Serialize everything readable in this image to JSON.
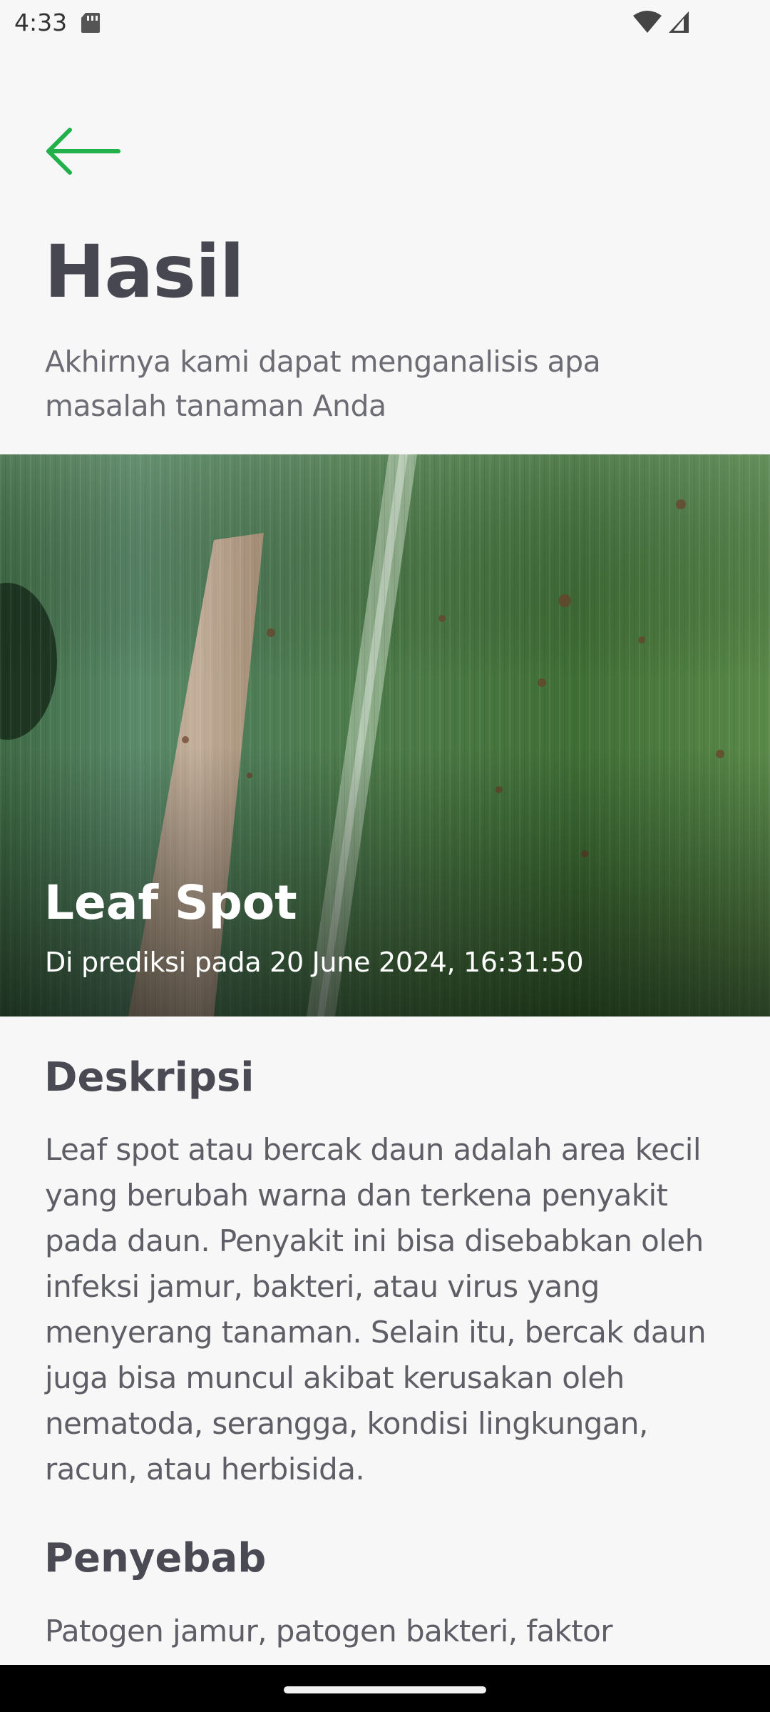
{
  "status_bar": {
    "time": "4:33",
    "icons": [
      "sd-card-icon",
      "wifi-icon",
      "signal-icon"
    ]
  },
  "header": {
    "back_icon": "arrow-left-icon",
    "title": "Hasil",
    "subtitle": "Akhirnya kami dapat menganalisis apa masalah tanaman Anda"
  },
  "result": {
    "disease_name": "Leaf Spot",
    "predicted_at": "Di prediksi pada 20 June 2024, 16:31:50"
  },
  "description": {
    "title": "Deskripsi",
    "body": "Leaf spot atau bercak daun adalah area kecil yang berubah warna dan terkena penyakit pada daun. Penyakit ini bisa disebabkan oleh infeksi jamur, bakteri, atau virus yang menyerang tanaman. Selain itu, bercak daun juga bisa muncul akibat kerusakan oleh nematoda, serangga, kondisi lingkungan, racun, atau herbisida."
  },
  "cause": {
    "title": "Penyebab",
    "body": "Patogen jamur, patogen bakteri, faktor"
  },
  "colors": {
    "accent": "#22b04b",
    "title_text": "#474752",
    "body_text": "#5e5e66",
    "background": "#f7f7f8"
  }
}
